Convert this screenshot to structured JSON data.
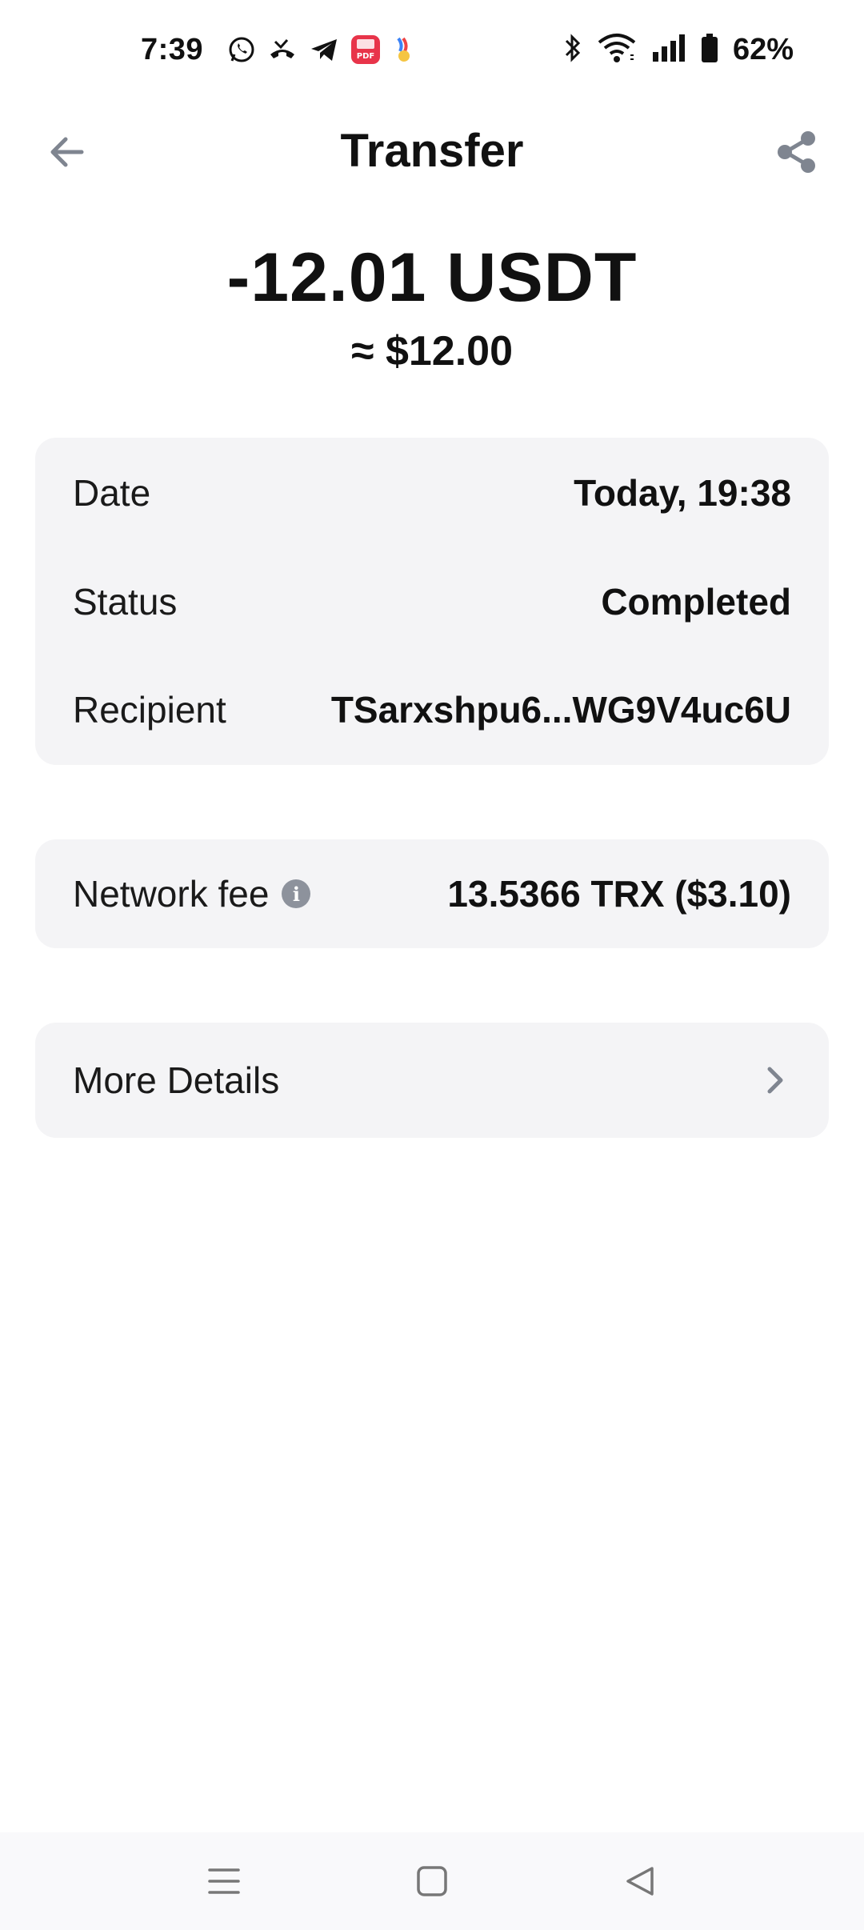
{
  "status_bar": {
    "time": "7:39",
    "battery": "62%",
    "notification_icons": [
      "whatsapp-icon",
      "missed-call-icon",
      "telegram-icon",
      "pdf-app-icon",
      "colorful-app-icon"
    ],
    "system_icons": [
      "bluetooth-icon",
      "wifi-icon",
      "signal-icon",
      "battery-icon"
    ]
  },
  "header": {
    "title": "Transfer",
    "back_icon": "arrow-left-icon",
    "share_icon": "share-icon"
  },
  "amount": {
    "main": "-12.01 USDT",
    "fiat": "≈ $12.00"
  },
  "details": {
    "date_label": "Date",
    "date_value": "Today, 19:38",
    "status_label": "Status",
    "status_value": "Completed",
    "recipient_label": "Recipient",
    "recipient_value": "TSarxshpu6...WG9V4uc6U"
  },
  "fee": {
    "label": "Network fee",
    "info_icon": "info-icon",
    "value": "13.5366 TRX ($3.10)"
  },
  "more": {
    "label": "More Details",
    "chevron_icon": "chevron-right-icon"
  },
  "nav": {
    "items": [
      "menu-icon",
      "home-square-icon",
      "back-triangle-icon"
    ]
  },
  "colors": {
    "card_background": "#f4f4f6",
    "icon_gray": "#8d929c",
    "text_primary": "#111111"
  }
}
